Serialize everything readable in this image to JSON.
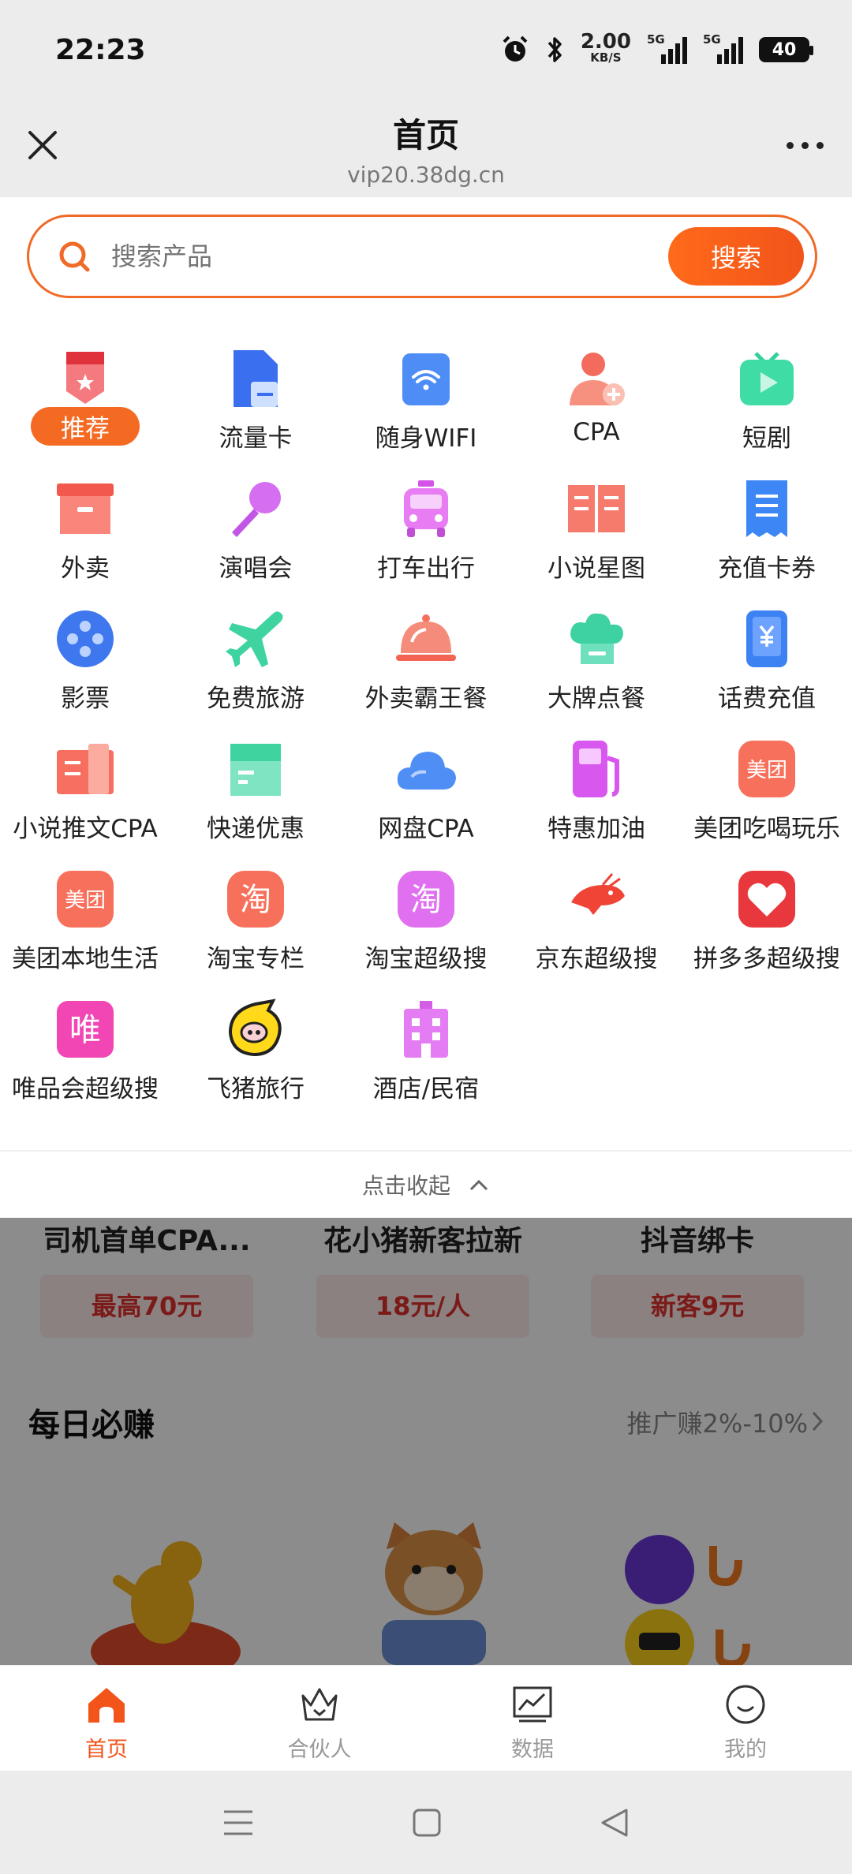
{
  "status_bar": {
    "time": "22:23",
    "net_speed_value": "2.00",
    "net_speed_unit": "KB/S",
    "signal1_label": "5G",
    "signal2_label": "5G",
    "battery_level": "40"
  },
  "title_bar": {
    "title": "首页",
    "url": "vip20.38dg.cn"
  },
  "search": {
    "placeholder": "搜索产品",
    "button_label": "搜索"
  },
  "categories": [
    {
      "label": "推荐",
      "icon": "recommend-badge-icon"
    },
    {
      "label": "流量卡",
      "icon": "sim-card-icon"
    },
    {
      "label": "随身WIFI",
      "icon": "wifi-icon"
    },
    {
      "label": "CPA",
      "icon": "user-add-icon"
    },
    {
      "label": "短剧",
      "icon": "tv-play-icon"
    },
    {
      "label": "外卖",
      "icon": "delivery-box-icon"
    },
    {
      "label": "演唱会",
      "icon": "microphone-icon"
    },
    {
      "label": "打车出行",
      "icon": "taxi-icon"
    },
    {
      "label": "小说星图",
      "icon": "book-icon"
    },
    {
      "label": "充值卡券",
      "icon": "voucher-icon"
    },
    {
      "label": "影票",
      "icon": "film-reel-icon"
    },
    {
      "label": "免费旅游",
      "icon": "airplane-icon"
    },
    {
      "label": "外卖霸王餐",
      "icon": "dish-cloche-icon"
    },
    {
      "label": "大牌点餐",
      "icon": "chef-hat-icon"
    },
    {
      "label": "话费充值",
      "icon": "phone-yuan-icon"
    },
    {
      "label": "小说推文CPA",
      "icon": "novel-icon"
    },
    {
      "label": "快递优惠",
      "icon": "parcel-icon"
    },
    {
      "label": "网盘CPA",
      "icon": "cloud-icon"
    },
    {
      "label": "特惠加油",
      "icon": "fuel-pump-icon"
    },
    {
      "label": "美团吃喝玩乐",
      "icon": "meituan-icon",
      "text": "美团"
    },
    {
      "label": "美团本地生活",
      "icon": "meituan-icon",
      "text": "美团"
    },
    {
      "label": "淘宝专栏",
      "icon": "taobao-icon",
      "text": "淘"
    },
    {
      "label": "淘宝超级搜",
      "icon": "taobao-icon",
      "text": "淘"
    },
    {
      "label": "京东超级搜",
      "icon": "jd-shrimp-icon"
    },
    {
      "label": "拼多多超级搜",
      "icon": "pinduoduo-icon"
    },
    {
      "label": "唯品会超级搜",
      "icon": "vipshop-icon",
      "text": "唯"
    },
    {
      "label": "飞猪旅行",
      "icon": "fliggy-pig-icon"
    },
    {
      "label": "酒店/民宿",
      "icon": "hotel-icon"
    }
  ],
  "collapse_label": "点击收起",
  "promo_cards": [
    {
      "title": "司机首单CPA...",
      "chip": "最高70元"
    },
    {
      "title": "花小猪新客拉新",
      "chip": "18元/人"
    },
    {
      "title": "抖音绑卡",
      "chip": "新客9元"
    }
  ],
  "daily": {
    "title": "每日必赚",
    "subtitle": "推广赚2%-10%"
  },
  "bottom_nav": [
    {
      "label": "首页",
      "active": true,
      "icon": "home-icon"
    },
    {
      "label": "合伙人",
      "active": false,
      "icon": "crown-icon"
    },
    {
      "label": "数据",
      "active": false,
      "icon": "chart-icon"
    },
    {
      "label": "我的",
      "active": false,
      "icon": "smile-icon"
    }
  ],
  "colors": {
    "accent": "#f2541a",
    "chip_text": "#e0322e"
  }
}
